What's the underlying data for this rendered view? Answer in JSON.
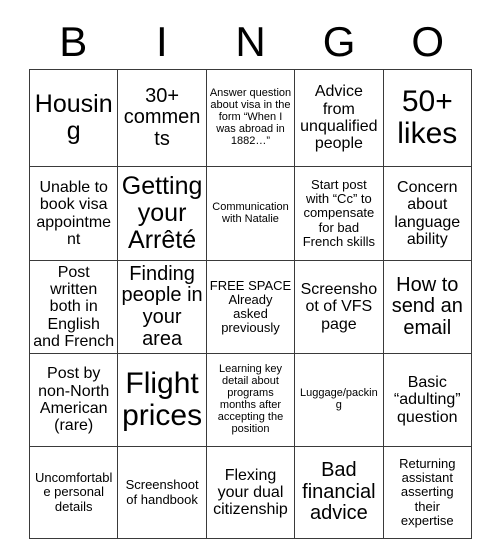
{
  "card": {
    "header_letters": [
      "B",
      "I",
      "N",
      "G",
      "O"
    ],
    "rows": [
      [
        {
          "text": "Housing",
          "size": "t-xl"
        },
        {
          "text": "30+ comments",
          "size": "t-lg"
        },
        {
          "text": "Answer question about visa in the form “When I was abroad in 1882…”",
          "size": "t-xs"
        },
        {
          "text": "Advice from unqualified people",
          "size": "t-md"
        },
        {
          "text": "50+ likes",
          "size": "t-xxl"
        }
      ],
      [
        {
          "text": "Unable to book visa appointment",
          "size": "t-md"
        },
        {
          "text": "Getting your Arrêté",
          "size": "t-xl"
        },
        {
          "text": "Communication with Natalie",
          "size": "t-xs"
        },
        {
          "text": "Start post with “Cc” to compensate for bad French skills",
          "size": "t-sm"
        },
        {
          "text": "Concern about language ability",
          "size": "t-md"
        }
      ],
      [
        {
          "text": "Post written both in English and French",
          "size": "t-md"
        },
        {
          "text": "Finding people in your area",
          "size": "t-lg"
        },
        {
          "text": "FREE SPACE Already asked previously",
          "size": "t-sm"
        },
        {
          "text": "Screenshoot of VFS page",
          "size": "t-md"
        },
        {
          "text": "How to send an email",
          "size": "t-lg"
        }
      ],
      [
        {
          "text": "Post by non-North American (rare)",
          "size": "t-md"
        },
        {
          "text": "Flight prices",
          "size": "t-xxl"
        },
        {
          "text": "Learning key detail about programs months after accepting the position",
          "size": "t-xs"
        },
        {
          "text": "Luggage/packing",
          "size": "t-xs"
        },
        {
          "text": "Basic “adulting” question",
          "size": "t-md"
        }
      ],
      [
        {
          "text": "Uncomfortable personal details",
          "size": "t-sm"
        },
        {
          "text": "Screenshoot of handbook",
          "size": "t-sm"
        },
        {
          "text": "Flexing your dual citizenship",
          "size": "t-md"
        },
        {
          "text": "Bad financial advice",
          "size": "t-lg"
        },
        {
          "text": "Returning assistant asserting their expertise",
          "size": "t-sm"
        }
      ]
    ]
  },
  "colors": {
    "background": "#ffffff",
    "text": "#000000",
    "grid_line": "#3a3a3a"
  }
}
